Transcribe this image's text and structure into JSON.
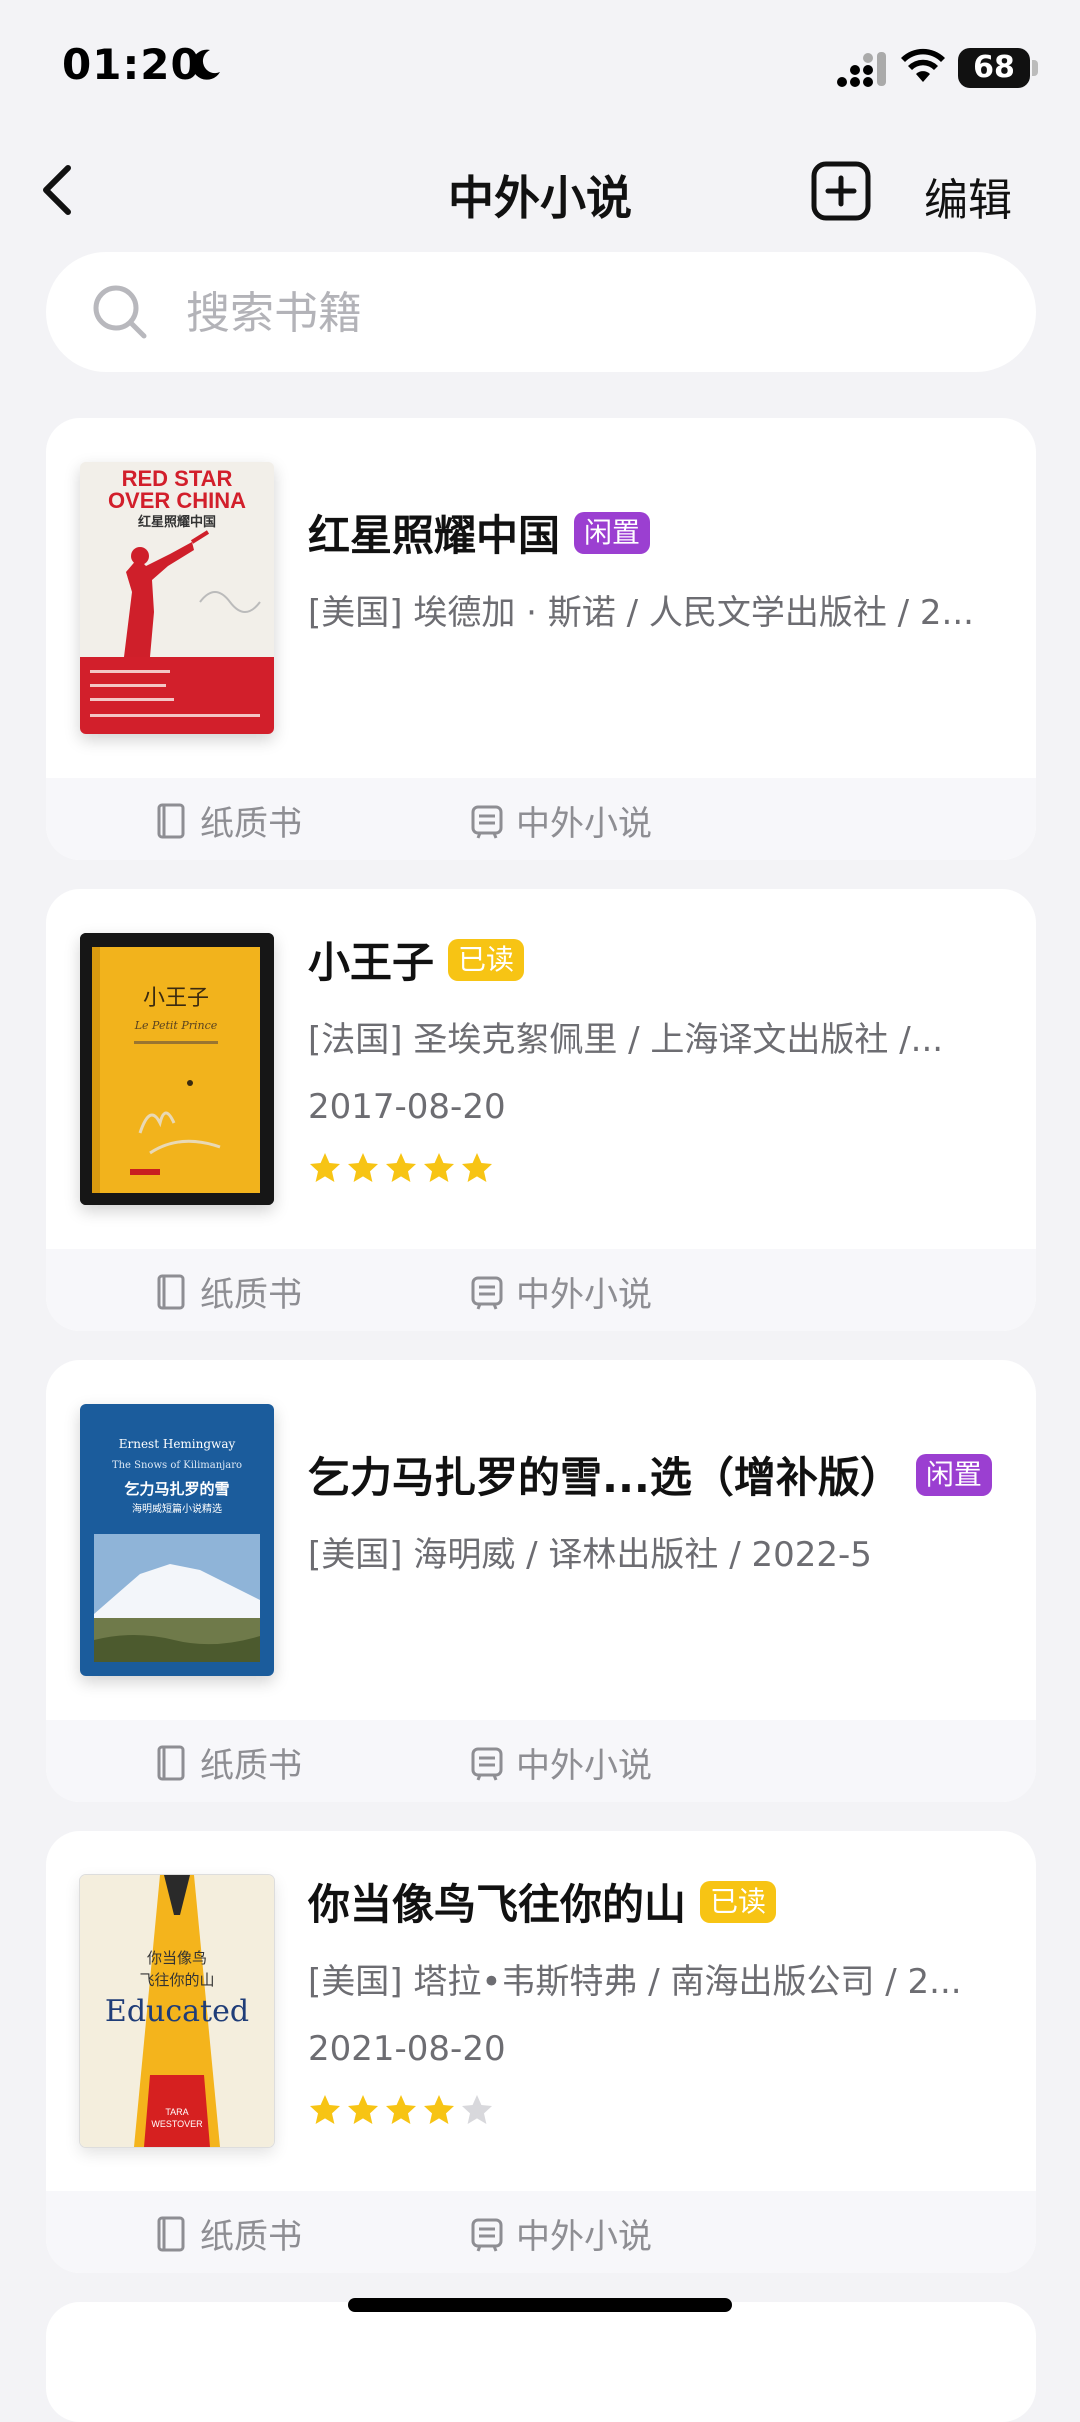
{
  "status": {
    "time": "01:20",
    "battery": "68"
  },
  "nav": {
    "title": "中外小说",
    "edit_label": "编辑"
  },
  "search": {
    "placeholder": "搜索书籍"
  },
  "books": [
    {
      "title": "红星照耀中国",
      "badge": "闲置",
      "badge_type": "idle",
      "meta": "[美国] 埃德加 · 斯诺 / 人民文学出版社 / 2...",
      "cover": {
        "line1": "RED STAR",
        "line2": "OVER CHINA",
        "cn": "红星照耀中国"
      },
      "format_label": "纸质书",
      "category_label": "中外小说"
    },
    {
      "title": "小王子",
      "badge": "已读",
      "badge_type": "read",
      "meta": "[法国] 圣埃克絮佩里 / 上海译文出版社 /...",
      "date": "2017-08-20",
      "rating": 5,
      "cover": {
        "cn": "小王子",
        "en": "Le Petit Prince"
      },
      "format_label": "纸质书",
      "category_label": "中外小说"
    },
    {
      "title": "乞力马扎罗的雪...选（增补版）",
      "badge": "闲置",
      "badge_type": "idle",
      "meta": "[美国] 海明威 / 译林出版社 /  2022-5",
      "cover": {
        "author": "Ernest Hemingway",
        "en": "The Snows of Kilimanjaro",
        "cn": "乞力马扎罗的雪",
        "sub": "海明威短篇小说精选"
      },
      "format_label": "纸质书",
      "category_label": "中外小说"
    },
    {
      "title": "你当像鸟飞往你的山",
      "badge": "已读",
      "badge_type": "read",
      "meta": "[美国] 塔拉•韦斯特弗 / 南海出版公司 / 2...",
      "date": "2021-08-20",
      "rating": 4,
      "cover": {
        "cn1": "你当像鸟",
        "cn2": "飞往你的山",
        "en": "Educated",
        "author1": "TARA",
        "author2": "WESTOVER"
      },
      "format_label": "纸质书",
      "category_label": "中外小说"
    }
  ],
  "colors": {
    "idle_badge": "#9b3fd1",
    "read_badge": "#f7c414",
    "star": "#f7c414",
    "star_empty": "#d8d8dc"
  }
}
